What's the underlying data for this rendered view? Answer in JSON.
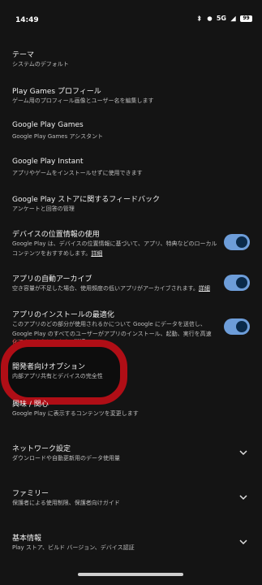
{
  "status_bar": {
    "time": "14:49",
    "network": "5G",
    "battery": "99"
  },
  "settings": [
    {
      "title": "テーマ",
      "subtitle": "システムのデフォルト"
    },
    {
      "title": "Play Games プロフィール",
      "subtitle": "ゲーム用のプロフィール画像とユーザー名を編集します"
    },
    {
      "title": "Google Play Games",
      "subtitle": "Google Play Games アシスタント"
    },
    {
      "title": "Google Play Instant",
      "subtitle": "アプリやゲームをインストールせずに使用できます"
    },
    {
      "title": "Google Play ストアに関するフィードバック",
      "subtitle": "アンケートと回答の管理"
    },
    {
      "title": "デバイスの位置情報の使用",
      "lines": [
        "Google Play は、デバイスの位置情報に基づいて、アプリ、特典などのローカル",
        "コンテンツをおすすめします。"
      ],
      "detail": "詳細",
      "toggle": true
    },
    {
      "title": "アプリの自動アーカイブ",
      "lines": [
        "空き容量が不足した場合、使用頻度の低いアプリがアーカイブされます。"
      ],
      "detail": "詳細",
      "toggle": true
    },
    {
      "title": "アプリのインストールの最適化",
      "lines": [
        "このアプリのどの部分が使用されるかについて Google にデータを送信し、",
        "Google Play のすべてのユーザーがアプリのインストール、起動、実行を高速"
      ],
      "warn_line": "化できるようにします。",
      "detail": "詳細",
      "toggle": true
    },
    {
      "title": "開発者向けオプション",
      "subtitle": "内部アプリ共有とデバイスの完全性"
    },
    {
      "title": "興味 / 関心",
      "subtitle": "Google Play に表示するコンテンツを変更します"
    },
    {
      "title": "ネットワーク設定",
      "subtitle": "ダウンロードや自動更新用のデータ使用量",
      "chevron": true
    },
    {
      "title": "ファミリー",
      "subtitle": "保護者による使用制限、保護者向けガイド",
      "chevron": true
    },
    {
      "title": "基本情報",
      "subtitle": "Play ストア、ビルド バージョン、デバイス認証",
      "chevron": true
    }
  ]
}
